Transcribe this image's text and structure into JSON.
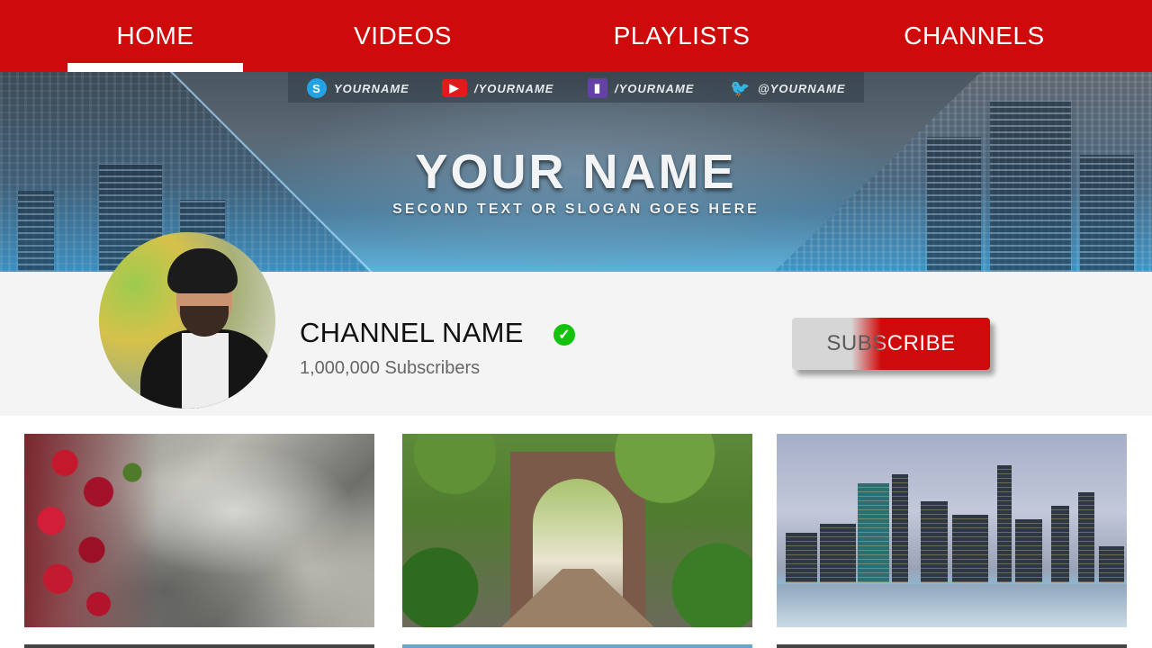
{
  "nav": {
    "tabs": [
      {
        "label": "HOME",
        "active": true
      },
      {
        "label": "VIDEOS",
        "active": false
      },
      {
        "label": "PLAYLISTS",
        "active": false
      },
      {
        "label": "CHANNELS",
        "active": false
      }
    ],
    "bg_color": "#cf0a0a"
  },
  "banner": {
    "socials": [
      {
        "icon": "skype-icon",
        "handle": "YOURNAME"
      },
      {
        "icon": "youtube-icon",
        "handle": "/YOURNAME"
      },
      {
        "icon": "twitch-icon",
        "handle": "/YOURNAME"
      },
      {
        "icon": "twitter-icon",
        "handle": "@YOURNAME"
      }
    ],
    "title": "YOUR NAME",
    "slogan": "SECOND TEXT OR SLOGAN GOES HERE"
  },
  "channel": {
    "name": "CHANNEL NAME",
    "subscribers": "1,000,000 Subscribers",
    "verified_color": "#14c20c",
    "subscribe_label": "SUBSCRIBE"
  },
  "thumbnails": [
    {
      "icon": "ivy-wall-image"
    },
    {
      "icon": "garden-arch-image"
    },
    {
      "icon": "city-skyline-image"
    }
  ]
}
